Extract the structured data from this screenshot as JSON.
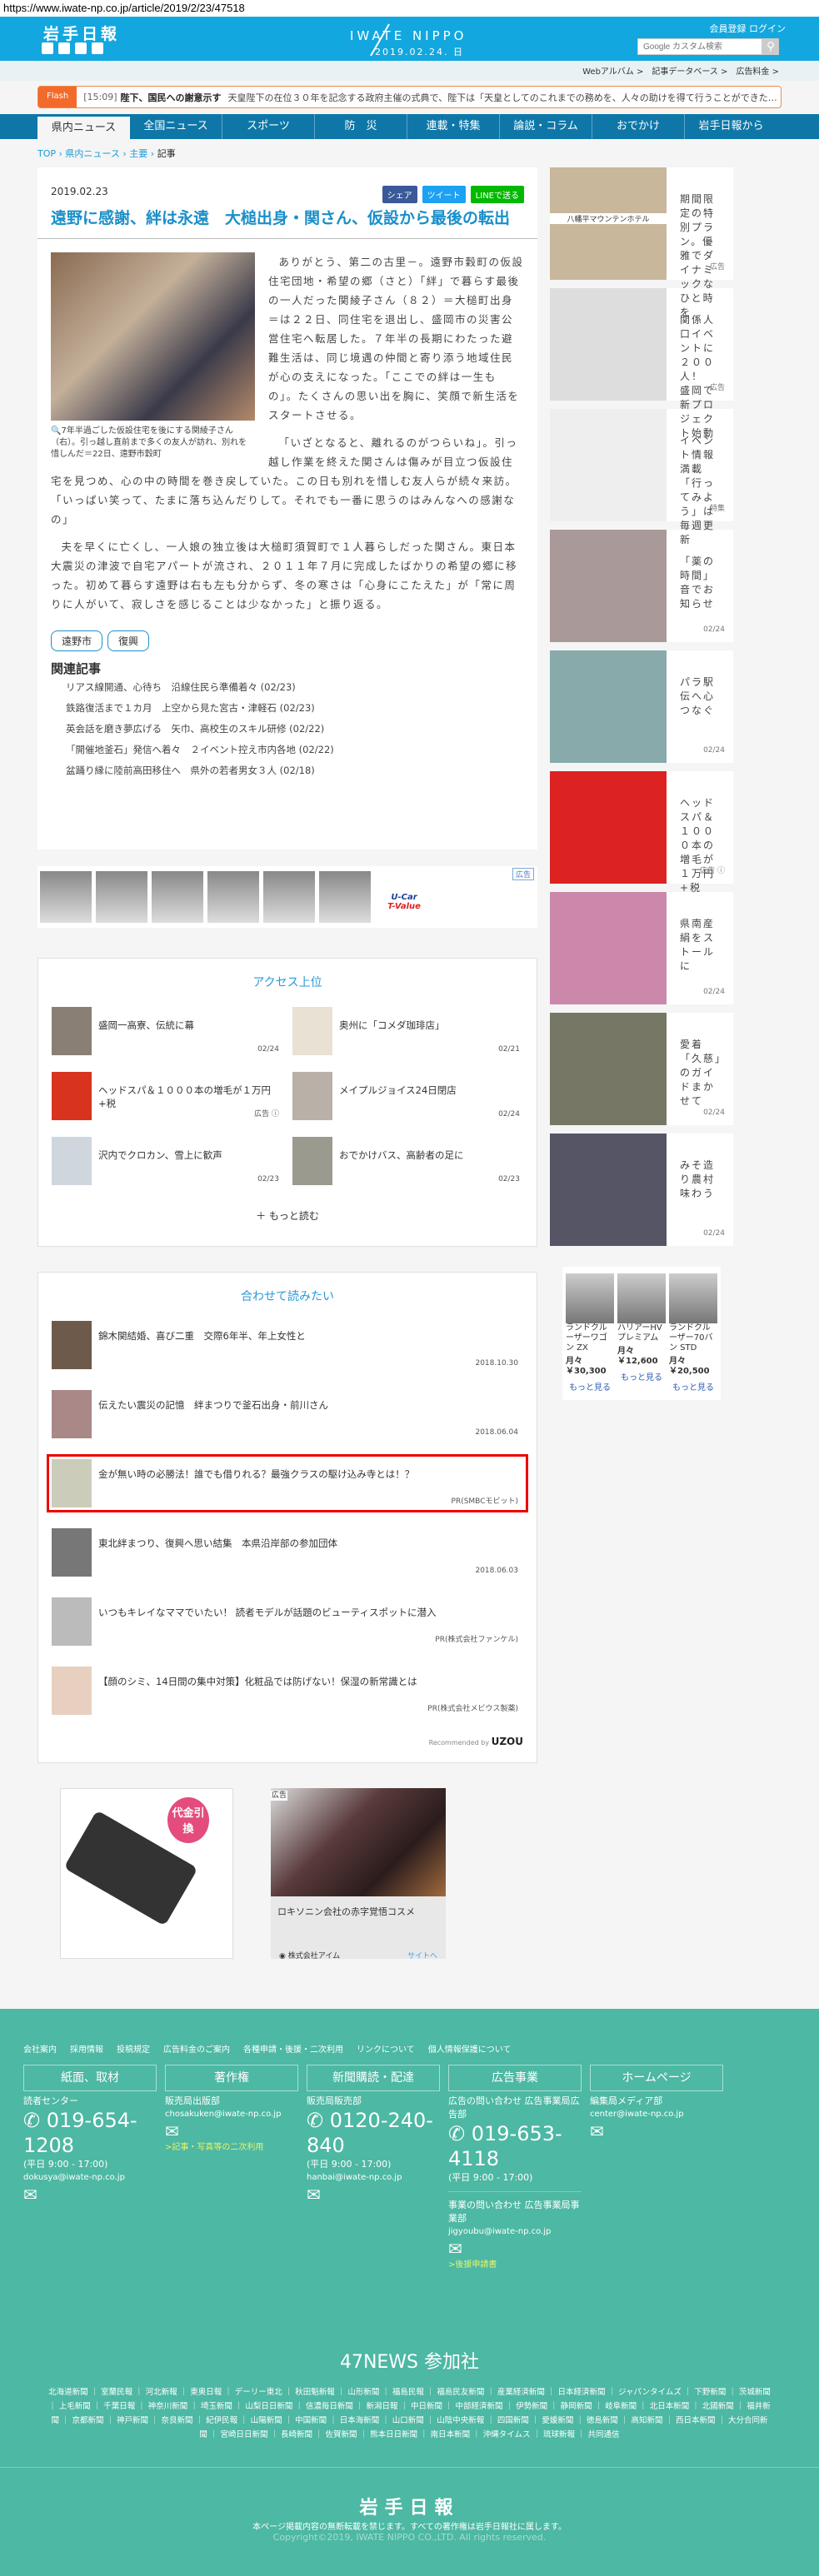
{
  "url": "https://www.iwate-np.co.jp/article/2019/2/23/47518",
  "header": {
    "logo": "岩手日報",
    "brand": "IWATE NIPPO",
    "date": "2019.02.24. 日",
    "register": "会員登録",
    "login": "ログイン",
    "search_placeholder": "Google カスタム検索"
  },
  "subnav": [
    "Webアルバム >",
    "記事データベース >",
    "広告料金 >"
  ],
  "flash": {
    "tag": "Flash",
    "time": "[15:09]",
    "headline": "陛下、国民への謝意示す",
    "body": "天皇陛下の在位３０年を記念する政府主催の式典で、陛下は「天皇としてのこれまでの務めを、人々の助けを得て行うことができた…"
  },
  "nav": [
    "県内ニュース",
    "全国ニュース",
    "スポーツ",
    "防　災",
    "連載・特集",
    "論説・コラム",
    "おでかけ",
    "岩手日報から"
  ],
  "breadcrumb": [
    "TOP",
    "県内ニュース",
    "主要",
    "記事"
  ],
  "article": {
    "date": "2019.02.23",
    "share": [
      "シェア",
      "ツイート",
      "LINEで送る"
    ],
    "title": "遠野に感謝、絆は永遠　大槌出身・関さん、仮設から最後の転出",
    "caption": "7年半過ごした仮設住宅を後にする関綾子さん（右）。引っ越し直前まで多くの友人が訪れ、別れを惜しんだ＝22日、遠野市穀町",
    "paragraphs": [
      "ありがとう、第二の古里－。遠野市穀町の仮設住宅団地・希望の郷（さと）「絆」で暮らす最後の一人だった関綾子さん（８２）＝大槌町出身＝は２２日、同住宅を退出し、盛岡市の災害公営住宅へ転居した。７年半の長期にわたった避難生活は、同じ境遇の仲間と寄り添う地域住民が心の支えになった。「ここでの絆は一生もの」。たくさんの思い出を胸に、笑顔で新生活をスタートさせる。",
      "「いざとなると、離れるのがつらいね」。引っ越し作業を終えた関さんは傷みが目立つ仮設住宅を見つめ、心の中の時間を巻き戻していた。この日も別れを惜しむ友人らが続々来訪。「いっぱい笑って、たまに落ち込んだりして。それでも一番に思うのはみんなへの感謝なの」",
      "夫を早くに亡くし、一人娘の独立後は大槌町須賀町で１人暮らしだった関さん。東日本大震災の津波で自宅アパートが流され、２０１１年７月に完成したばかりの希望の郷に移った。初めて暮らす遠野は右も左も分からず、冬の寒さは「心身にこたえた」が「常に周りに人がいて、寂しさを感じることは少なかった」と振り返る。"
    ],
    "tags": [
      "遠野市",
      "復興"
    ],
    "related_title": "関連記事",
    "related": [
      "リアス線開通、心待ち　沿線住民ら準備着々 (02/23)",
      "鉄路復活まで１カ月　上空から見た宮古・津軽石 (02/23)",
      "英会話を磨き夢広げる　矢巾、高校生のスキル研修 (02/22)",
      "「開催地釜石」発信へ着々　２イベント控え市内各地 (02/22)",
      "盆踊り縁に陸前高田移住へ　県外の若者男女３人 (02/18)"
    ]
  },
  "car_strip": {
    "ad_label": "広告",
    "logo1": "U-Car",
    "logo2": "T-Value"
  },
  "ranking": {
    "title": "アクセス上位",
    "items": [
      {
        "t": "盛岡一高寮、伝統に幕",
        "d": "02/24"
      },
      {
        "t": "奥州に「コメダ珈琲店」",
        "d": "02/21"
      },
      {
        "t": "ヘッドスパ＆１０００本の増毛が１万円+税",
        "d": "広告 ⓘ"
      },
      {
        "t": "メイプルジョイス24日閉店",
        "d": "02/24"
      },
      {
        "t": "沢内でクロカン、雪上に歓声",
        "d": "02/23"
      },
      {
        "t": "おでかけバス、高齢者の足に",
        "d": "02/23"
      }
    ],
    "more": "＋ もっと読む"
  },
  "recommend": {
    "title": "合わせて読みたい",
    "items": [
      {
        "t": "錦木関結婚、喜び二重　交際6年半、年上女性と",
        "d": "2018.10.30"
      },
      {
        "t": "伝えたい震災の記憶　絆まつりで釜石出身・前川さん",
        "d": "2018.06.04"
      },
      {
        "t": "金が無い時の必勝法！誰でも借りれる？最強クラスの駆け込み寺とは！？",
        "d": "PR(SMBCモビット)"
      },
      {
        "t": "東北絆まつり、復興へ思い結集　本県沿岸部の参加団体",
        "d": "2018.06.03"
      },
      {
        "t": "いつもキレイなママでいたい！ 読者モデルが話題のビューティスポットに潜入",
        "d": "PR(株式会社ファンケル)"
      },
      {
        "t": "【顔のシミ、14日間の集中対策】化粧品では防げない！保湿の新常識とは",
        "d": "PR(株式会社メビウス製薬)"
      }
    ],
    "by": "Recommended by",
    "brand": "UZOU"
  },
  "ads": {
    "ad1_badge": "代金引換",
    "ad2_label": "広告",
    "ad2_text": "ロキソニン会社の赤字覚悟コスメ",
    "ad2_company": "株式会社アイム",
    "ad2_link": "サイトへ"
  },
  "sidebar": [
    {
      "t": "期間限定の特別プラン。優雅でダイナミックなひと時を",
      "l": "広告",
      "img": "八幡平マウンテンホテル"
    },
    {
      "t": "関係人口イベントに２００人！　盛岡で新プロジェクト始動",
      "l": "広告"
    },
    {
      "t": "イベント情報満載「行ってみよう」は毎週更新",
      "l": "特集"
    },
    {
      "t": "「薬の時間」音でお知らせ",
      "l": "02/24"
    },
    {
      "t": "パラ駅伝へ心つなぐ",
      "l": "02/24"
    },
    {
      "t": "ヘッドスパ＆１０００本の増毛が１万円+税",
      "l": "広告 ⓘ"
    },
    {
      "t": "県南産絹をストールに",
      "l": "02/24"
    },
    {
      "t": "愛着「久慈」のガイドまかせて",
      "l": "02/24"
    },
    {
      "t": "みそ造り農村味わう",
      "l": "02/24"
    }
  ],
  "side_cars": [
    {
      "n": "ランドクルーザーワゴン ZX",
      "p": "月々 ￥30,300"
    },
    {
      "n": "ハリアーHV プレミアム",
      "p": "月々 ￥12,600"
    },
    {
      "n": "ランドクルーザー70バン STD",
      "p": "月々 ￥20,500"
    }
  ],
  "side_cars_more": "もっと見る",
  "footer": {
    "links": [
      "会社案内",
      "採用情報",
      "投稿規定",
      "広告料金のご案内",
      "各種申請・後援・二次利用",
      "リンクについて",
      "個人情報保護について"
    ],
    "cols": [
      {
        "box": "紙面、取材",
        "dept": "読者センター",
        "tel": "019-654-1208",
        "hours": "(平日 9:00 - 17:00)",
        "mail": "dokusya@iwate-np.co.jp"
      },
      {
        "box": "著作権",
        "dept": "販売局出版部",
        "mail": "chosakuken@iwate-np.co.jp",
        "link": ">記事・写真等の二次利用"
      },
      {
        "box": "新聞購読・配達",
        "dept": "販売局販売部",
        "tel": "0120-240-840",
        "hours": "(平日 9:00 - 17:00)",
        "mail": "hanbai@iwate-np.co.jp"
      },
      {
        "box": "広告事業",
        "dept": "広告の問い合わせ 広告事業局広告部",
        "tel": "019-653-4118",
        "hours": "(平日 9:00 - 17:00)",
        "dept2": "事業の問い合わせ 広告事業局事業部",
        "mail": "jigyoubu@iwate-np.co.jp",
        "link": ">後援申請書"
      },
      {
        "box": "ホームページ",
        "dept": "編集局メディア部",
        "mail": "center@iwate-np.co.jp"
      }
    ],
    "n47": "47NEWS 参加社",
    "papers": "北海道新聞 ｜ 室蘭民報 ｜ 河北新報 ｜ 東奥日報 ｜ デーリー東北 ｜ 秋田魁新報 ｜ 山形新聞 ｜ 福島民報 ｜ 福島民友新聞 ｜ 産業経済新聞 ｜ 日本経済新聞 ｜ ジャパンタイムズ ｜ 下野新聞 ｜ 茨城新聞 ｜ 上毛新聞 ｜ 千葉日報 ｜ 神奈川新聞 ｜ 埼玉新聞 ｜ 山梨日日新聞 ｜ 信濃毎日新聞 ｜ 新潟日報 ｜ 中日新聞 ｜ 中部経済新聞 ｜ 伊勢新聞 ｜ 静岡新聞 ｜ 岐阜新聞 ｜ 北日本新聞 ｜ 北國新聞 ｜ 福井新聞 ｜ 京都新聞 ｜ 神戸新聞 ｜ 奈良新聞 ｜ 紀伊民報 ｜ 山陽新聞 ｜ 中国新聞 ｜ 日本海新聞 ｜ 山口新聞 ｜ 山陰中央新報 ｜ 四国新聞 ｜ 愛媛新聞 ｜ 徳島新聞 ｜ 高知新聞 ｜ 西日本新聞 ｜ 大分合同新聞 ｜ 宮崎日日新聞 ｜ 長崎新聞 ｜ 佐賀新聞 ｜ 熊本日日新聞 ｜ 南日本新聞 ｜ 沖縄タイムス ｜ 琉球新報 ｜ 共同通信",
    "logo": "岩手日報",
    "notice": "本ページ掲載内容の無断転載を禁じます。すべての著作権は岩手日報社に属します。",
    "copyright": "Copyright©2019, IWATE NIPPO CO.,LTD. All rights reserved."
  }
}
